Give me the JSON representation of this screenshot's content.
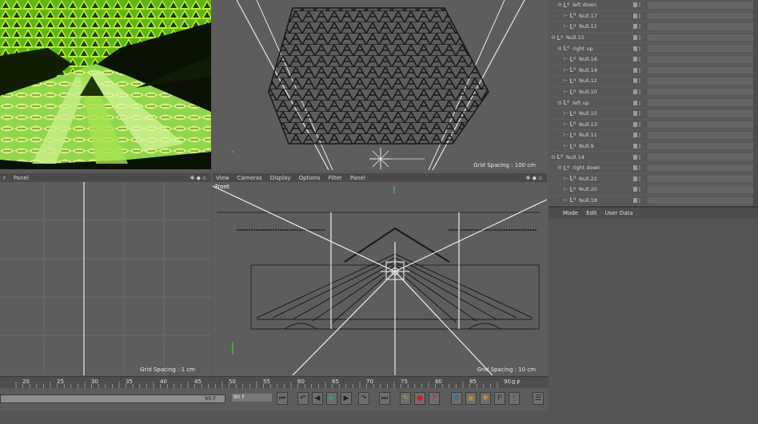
{
  "bottom_left_menu": [
    "r",
    "Panel"
  ],
  "front_menu": [
    "View",
    "Cameras",
    "Display",
    "Options",
    "Filter",
    "Panel"
  ],
  "top_viewport": {
    "grid_spacing": "Grid Spacing : 100 cm"
  },
  "left_viewport": {
    "grid_spacing": "Grid Spacing : 1 cm"
  },
  "front_viewport": {
    "label": "Front",
    "grid_spacing": "Grid Spacing : 10 cm"
  },
  "object_manager": {
    "rows": [
      {
        "label": "left down",
        "indent": 1,
        "group": true
      },
      {
        "label": "Null.17",
        "indent": 2,
        "group": false
      },
      {
        "label": "Null.11",
        "indent": 2,
        "group": false
      },
      {
        "label": "Null.15",
        "indent": 0,
        "group": true
      },
      {
        "label": "right up",
        "indent": 1,
        "group": true
      },
      {
        "label": "Null.16",
        "indent": 2,
        "group": false
      },
      {
        "label": "Null.14",
        "indent": 2,
        "group": false
      },
      {
        "label": "Null.12",
        "indent": 2,
        "group": false
      },
      {
        "label": "Null.10",
        "indent": 2,
        "group": false
      },
      {
        "label": "left up",
        "indent": 1,
        "group": true
      },
      {
        "label": "Null.15",
        "indent": 2,
        "group": false
      },
      {
        "label": "Null.13",
        "indent": 2,
        "group": false
      },
      {
        "label": "Null.11",
        "indent": 2,
        "group": false
      },
      {
        "label": "Null.9",
        "indent": 2,
        "group": false
      },
      {
        "label": "Null.14",
        "indent": 0,
        "group": true
      },
      {
        "label": "right down",
        "indent": 1,
        "group": true
      },
      {
        "label": "Null.22",
        "indent": 2,
        "group": false
      },
      {
        "label": "Null.20",
        "indent": 2,
        "group": false
      },
      {
        "label": "Null.18",
        "indent": 2,
        "group": false
      }
    ]
  },
  "attributes_menu": [
    "Mode",
    "Edit",
    "User Data"
  ],
  "timeline": {
    "ticks": [
      "20",
      "25",
      "30",
      "35",
      "40",
      "45",
      "50",
      "55",
      "60",
      "65",
      "70",
      "75",
      "80",
      "85",
      "90"
    ],
    "end_label": "0 F"
  },
  "transport": {
    "start_frame": "90 F",
    "end_frame": "90 F"
  },
  "colors": {
    "accent_green": "#7dd21c",
    "ui_dark": "#4a4a4a",
    "viewport_bg": "#5d5d5d"
  }
}
